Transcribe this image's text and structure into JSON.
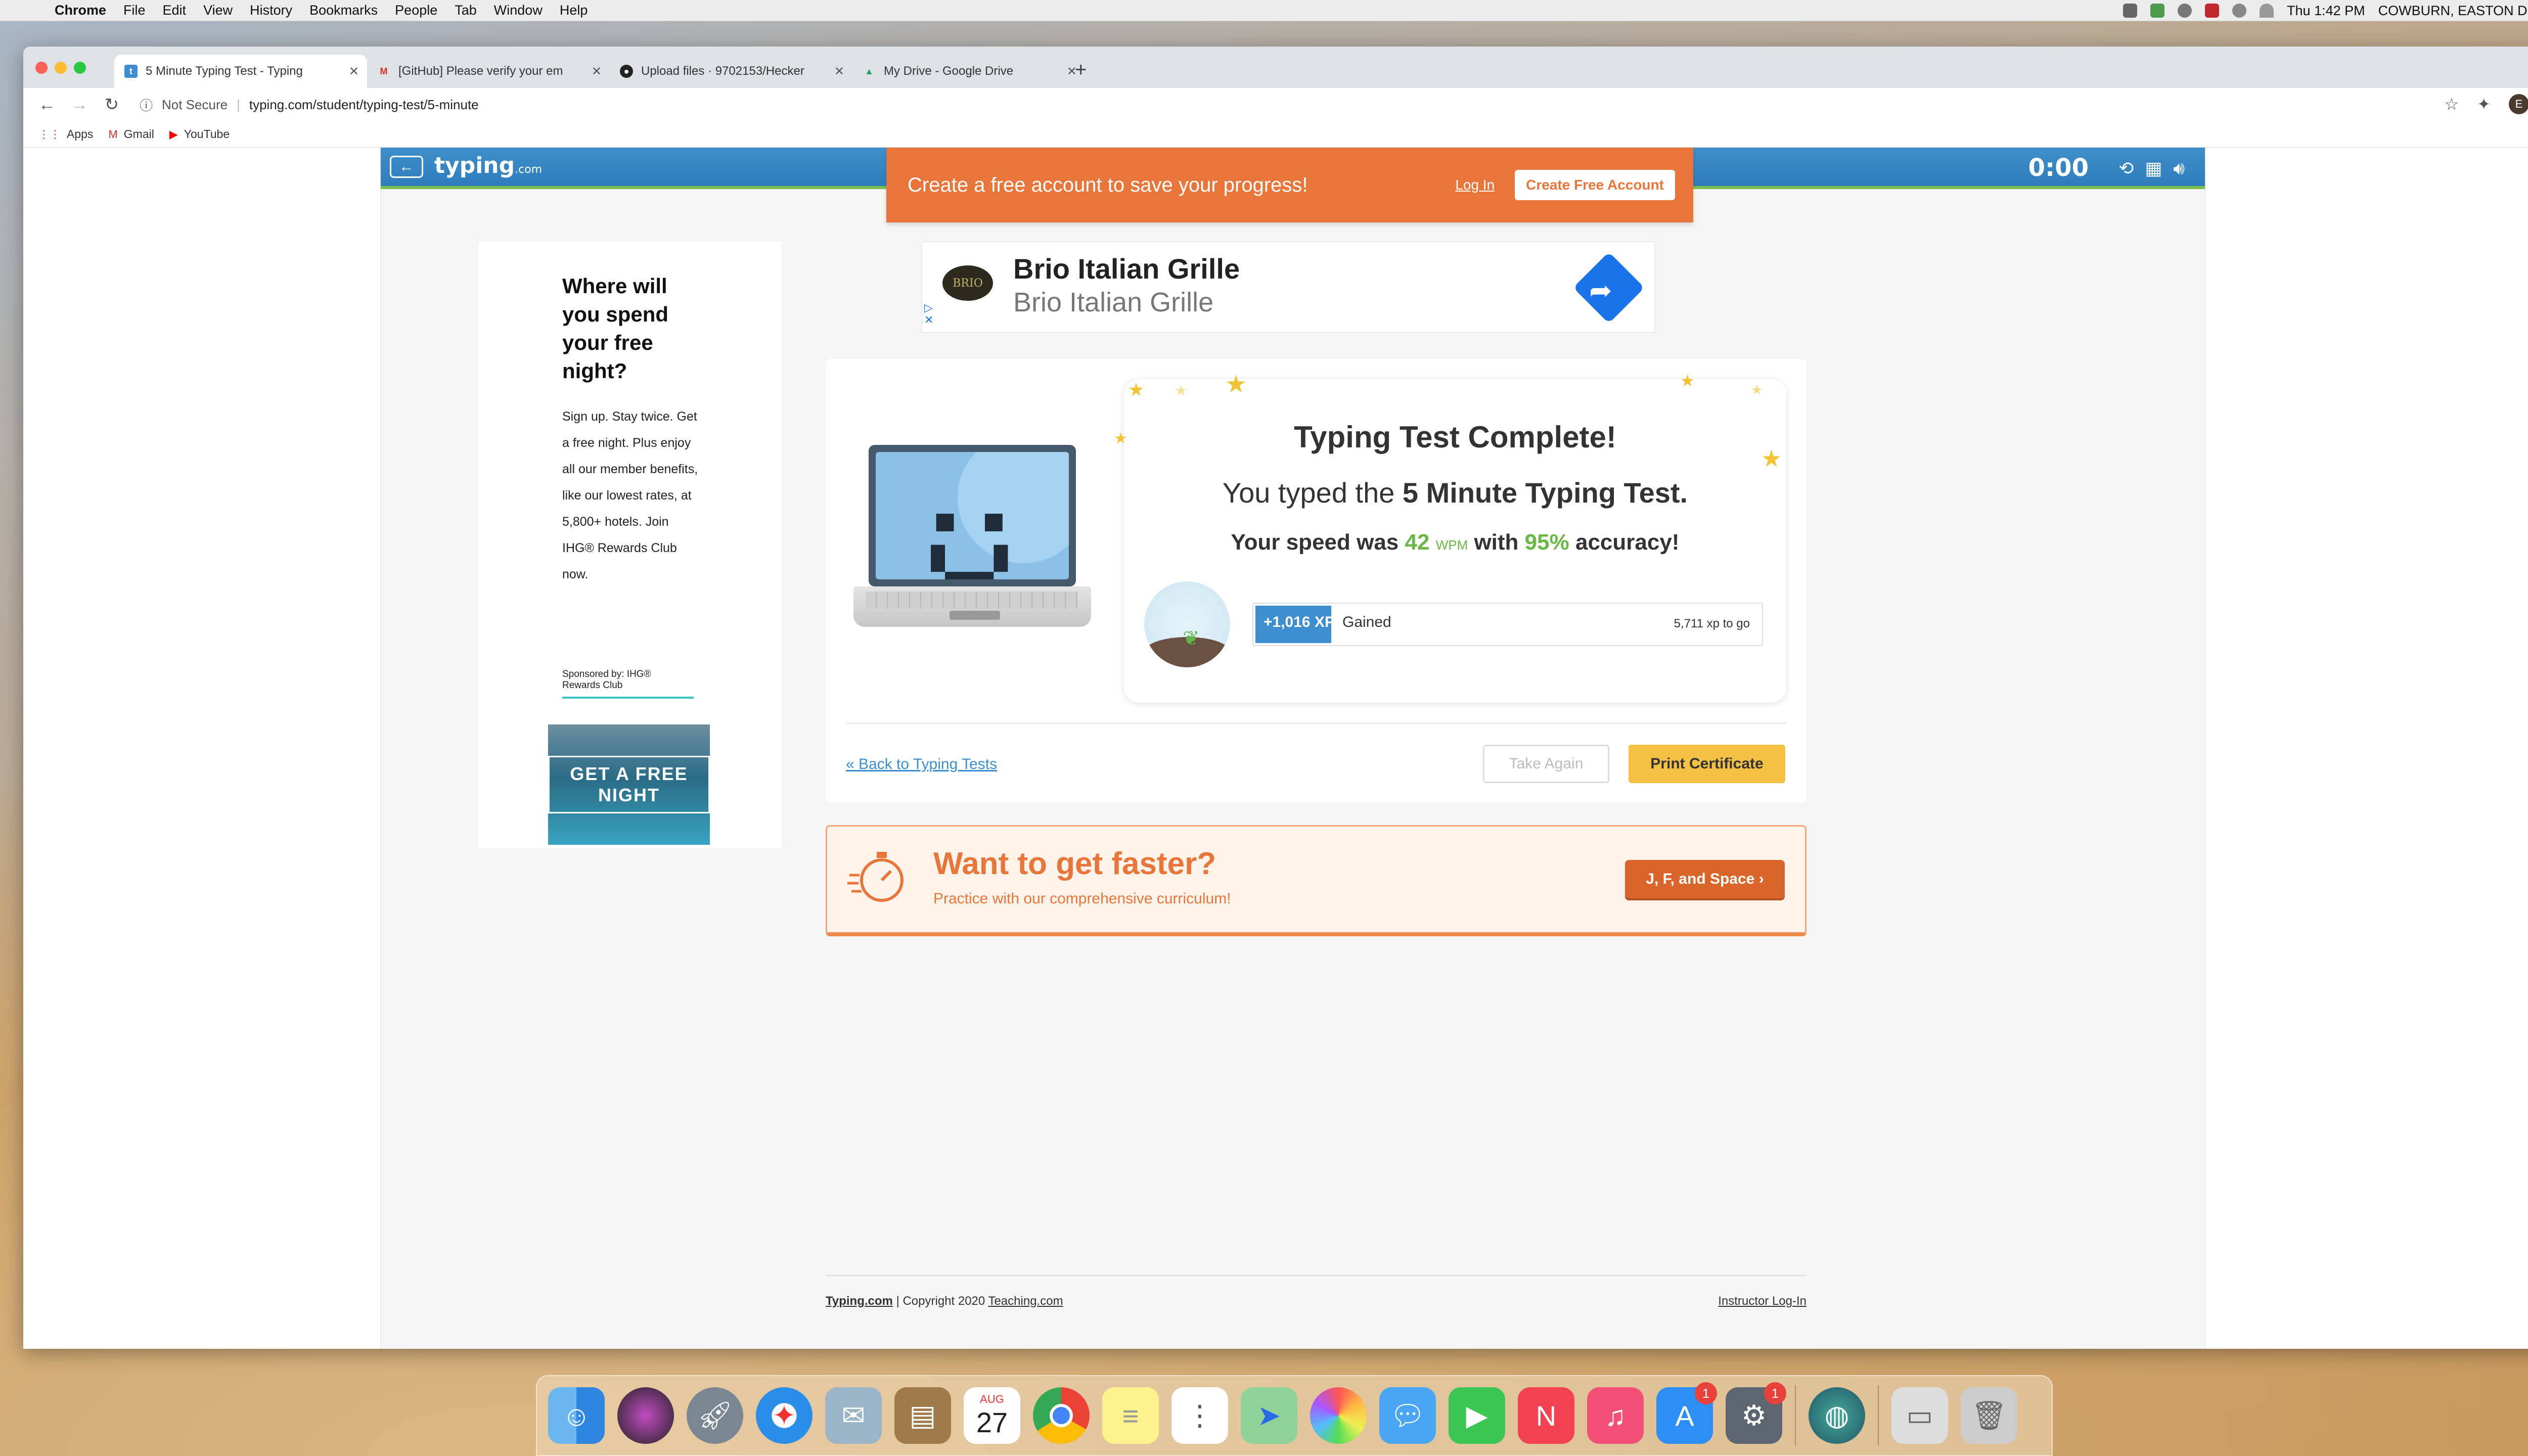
{
  "menubar": {
    "app": "Chrome",
    "items": [
      "File",
      "Edit",
      "View",
      "History",
      "Bookmarks",
      "People",
      "Tab",
      "Window",
      "Help"
    ],
    "clock": "Thu 1:42 PM",
    "user": "COWBURN, EASTON D"
  },
  "tabs": [
    {
      "title": "5 Minute Typing Test - Typing",
      "icon": "typing-favicon"
    },
    {
      "title": "[GitHub] Please verify your em",
      "icon": "gmail-icon"
    },
    {
      "title": "Upload files · 9702153/Hecker",
      "icon": "github-icon"
    },
    {
      "title": "My Drive - Google Drive",
      "icon": "drive-icon"
    }
  ],
  "toolbar": {
    "security": "Not Secure",
    "url": "typing.com/student/typing-test/5-minute",
    "avatar": "E"
  },
  "bookmarks": [
    {
      "label": "Apps",
      "icon": "apps-grid-icon"
    },
    {
      "label": "Gmail",
      "icon": "gmail-icon"
    },
    {
      "label": "YouTube",
      "icon": "youtube-icon"
    }
  ],
  "site": {
    "logo": "typing",
    "logo_suffix": ".com",
    "timer": "0:00"
  },
  "banner": {
    "text": "Create a free account to save your progress!",
    "login": "Log In",
    "create": "Create Free Account"
  },
  "left_ad": {
    "headline": "Where will you spend your free night?",
    "body": "Sign up. Stay twice. Get a free night. Plus enjoy all our member benefits, like our lowest rates, at 5,800+ hotels. Join IHG® Rewards Club now.",
    "sponsor": "Sponsored by: IHG® Rewards Club",
    "image_text": "GET A FREE NIGHT"
  },
  "top_ad": {
    "logo": "BRIO",
    "title": "Brio Italian Grille",
    "subtitle": "Brio Italian Grille"
  },
  "result": {
    "title": "Typing Test Complete!",
    "sub_prefix": "You typed the ",
    "sub_test": "5 Minute Typing Test.",
    "speed_prefix": "Your speed was ",
    "wpm_value": "42",
    "wpm_unit": "WPM",
    "speed_mid": " with ",
    "accuracy": "95%",
    "speed_suffix": " accuracy!",
    "xp_gained": "+1,016 XP",
    "xp_gained_label": "Gained",
    "xp_to_go": "5,711 xp to go",
    "xp_progress": 0.15
  },
  "actions": {
    "back": "« Back to Typing Tests",
    "again": "Take Again",
    "print": "Print Certificate"
  },
  "faster": {
    "title": "Want to get faster?",
    "subtitle": "Practice with our comprehensive curriculum!",
    "button": "J, F, and Space ›"
  },
  "footer": {
    "site": "Typing.com",
    "copyright": "Copyright 2020",
    "teaching": "Teaching.com",
    "instructor": "Instructor Log-In"
  },
  "dock": {
    "badges": {
      "app-store": "1",
      "system-preferences": "1"
    },
    "calendar_month": "AUG",
    "calendar_day": "27"
  }
}
